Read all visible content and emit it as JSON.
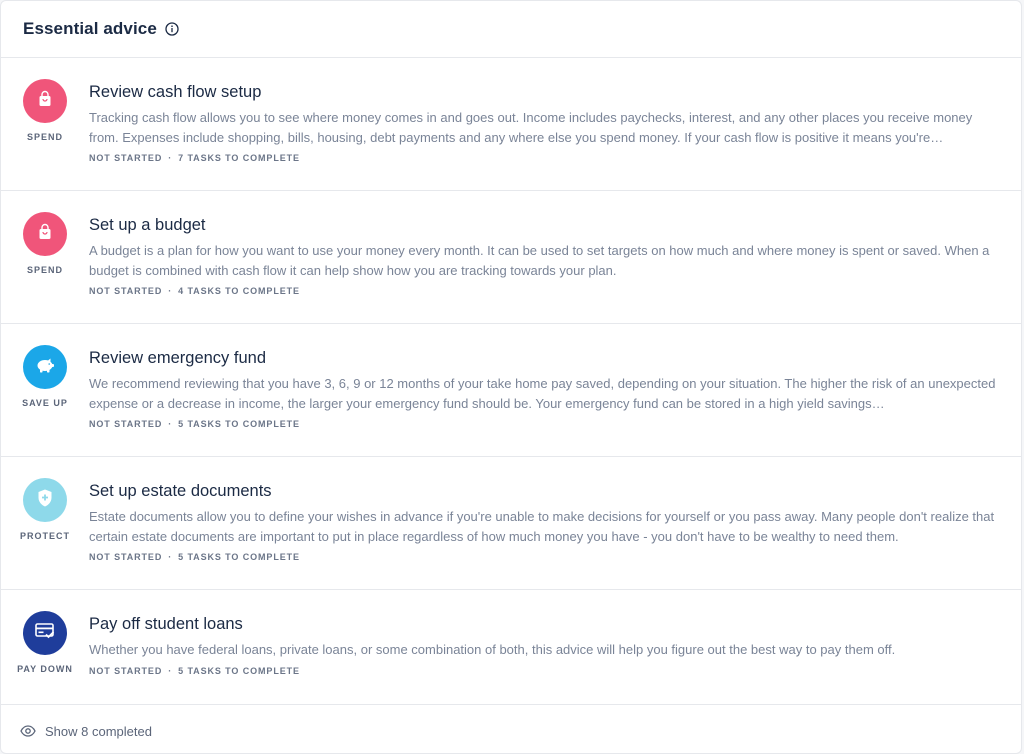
{
  "header": {
    "title": "Essential advice",
    "info_icon": "info-icon"
  },
  "items": [
    {
      "title": "Review cash flow setup",
      "description": "Tracking cash flow allows you to see where money comes in and goes out. Income includes paychecks, interest, and any other places you receive money from. Expenses include shopping, bills, housing, debt payments and any where else you spend money. If your cash flow is positive it means you're…",
      "category": "SPEND",
      "icon": "shopping-bag-icon",
      "color": "#f0557a",
      "status": "NOT STARTED",
      "tasks": "7 TASKS TO COMPLETE"
    },
    {
      "title": "Set up a budget",
      "description": "A budget is a plan for how you want to use your money every month. It can be used to set targets on how much and where money is spent or saved. When a budget is combined with cash flow it can help show how you are tracking towards your plan.",
      "category": "SPEND",
      "icon": "shopping-bag-icon",
      "color": "#f0557a",
      "status": "NOT STARTED",
      "tasks": "4 TASKS TO COMPLETE"
    },
    {
      "title": "Review emergency fund",
      "description": "We recommend reviewing that you have 3, 6, 9 or 12 months of your take home pay saved, depending on your situation. The higher the risk of an unexpected expense or a decrease in income, the larger your emergency fund should be. Your emergency fund can be stored in a high yield savings…",
      "category": "SAVE UP",
      "icon": "piggy-bank-icon",
      "color": "#1ba7e8",
      "status": "NOT STARTED",
      "tasks": "5 TASKS TO COMPLETE"
    },
    {
      "title": "Set up estate documents",
      "description": "Estate documents allow you to define your wishes in advance if you're unable to make decisions for yourself or you pass away. Many people don't realize that certain estate documents are important to put in place regardless of how much money you have - you don't have to be wealthy to need them.",
      "category": "PROTECT",
      "icon": "shield-plus-icon",
      "color": "#8ed9ea",
      "status": "NOT STARTED",
      "tasks": "5 TASKS TO COMPLETE"
    },
    {
      "title": "Pay off student loans",
      "description": "Whether you have federal loans, private loans, or some combination of both, this advice will help you figure out the best way to pay them off.",
      "category": "PAY DOWN",
      "icon": "credit-card-check-icon",
      "color": "#1f3d9b",
      "status": "NOT STARTED",
      "tasks": "5 TASKS TO COMPLETE"
    }
  ],
  "footer": {
    "label": "Show 8 completed",
    "icon": "eye-icon"
  }
}
